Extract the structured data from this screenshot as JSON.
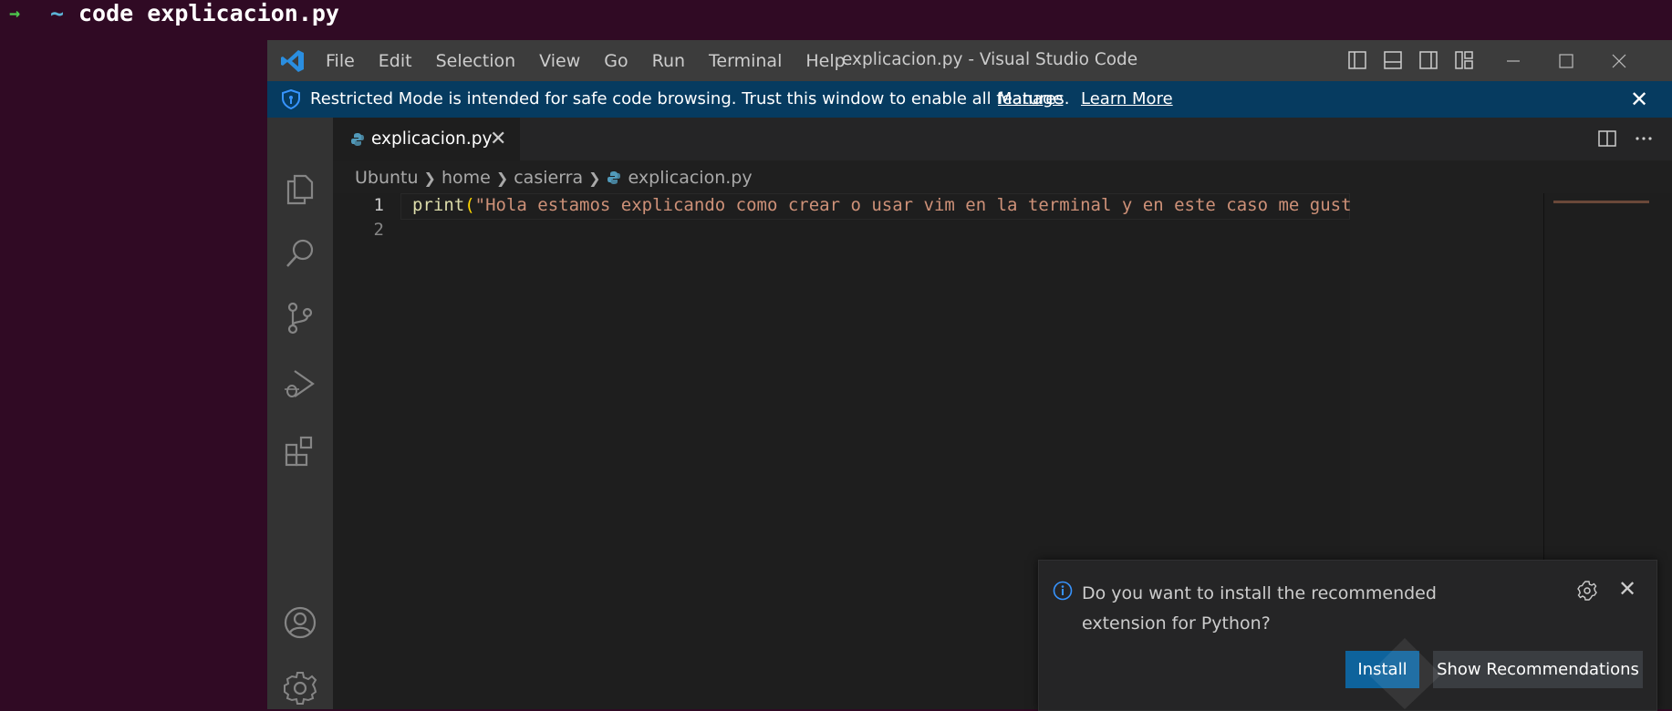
{
  "terminal": {
    "arrow": "→",
    "tilde": "~",
    "command": "code explicacion.py"
  },
  "window": {
    "title": "explicacion.py - Visual Studio Code",
    "menu": [
      "File",
      "Edit",
      "Selection",
      "View",
      "Go",
      "Run",
      "Terminal",
      "Help"
    ]
  },
  "banner": {
    "message": "Restricted Mode is intended for safe code browsing. Trust this window to enable all features.",
    "manage": "Manage",
    "learn_more": "Learn More"
  },
  "tab": {
    "label": "explicacion.py",
    "close": "✕"
  },
  "breadcrumb": [
    "Ubuntu",
    "home",
    "casierra",
    "explicacion.py"
  ],
  "editor": {
    "lines": [
      {
        "number": "1",
        "fn": "print",
        "paren": "(",
        "string": "\"Hola estamos explicando como crear o usar vim en la terminal y en este caso me gustaria realizarlo c"
      },
      {
        "number": "2"
      }
    ]
  },
  "notification": {
    "message": "Do you want to install the recommended extension for Python?",
    "install": "Install",
    "show_recommendations": "Show Recommendations"
  },
  "colors": {
    "accent": "#0e639c",
    "banner": "#063b60",
    "terminal_bg": "#300a24",
    "string": "#ce9178",
    "function": "#dcdcaa"
  }
}
